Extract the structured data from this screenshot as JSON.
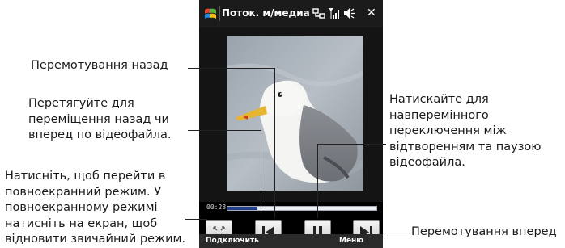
{
  "window": {
    "title": "Поток. м/медиа",
    "status_icons": [
      "connectivity-icon",
      "signal-icon",
      "volume-icon"
    ],
    "close_label": "✕"
  },
  "player": {
    "elapsed_time": "00:28",
    "progress_fraction": 0.2,
    "controls": [
      "fullscreen-icon",
      "rewind-icon",
      "pause-icon",
      "forward-icon"
    ]
  },
  "softkeys": {
    "left": "Подключить",
    "right": "Меню"
  },
  "callouts": {
    "rewind": "Перемотування назад",
    "seek": "Перетягуйте для\nпереміщення назад чи\nвперед по відеофайла.",
    "fullscreen": "Натисніть, щоб перейти в\nповноекранний режим. У\nповноекранному режимі\nнатисніть на екран, щоб\nвідновити звичайний режим.",
    "pause": "Натискайте для\nнавперемінного\nпереключення між\nвідтворенням та паузою\nвідеофайла.",
    "forward": "Перемотування вперед"
  },
  "colors": {
    "accent": "#1f3f8a",
    "phone_bg": "#000000"
  }
}
